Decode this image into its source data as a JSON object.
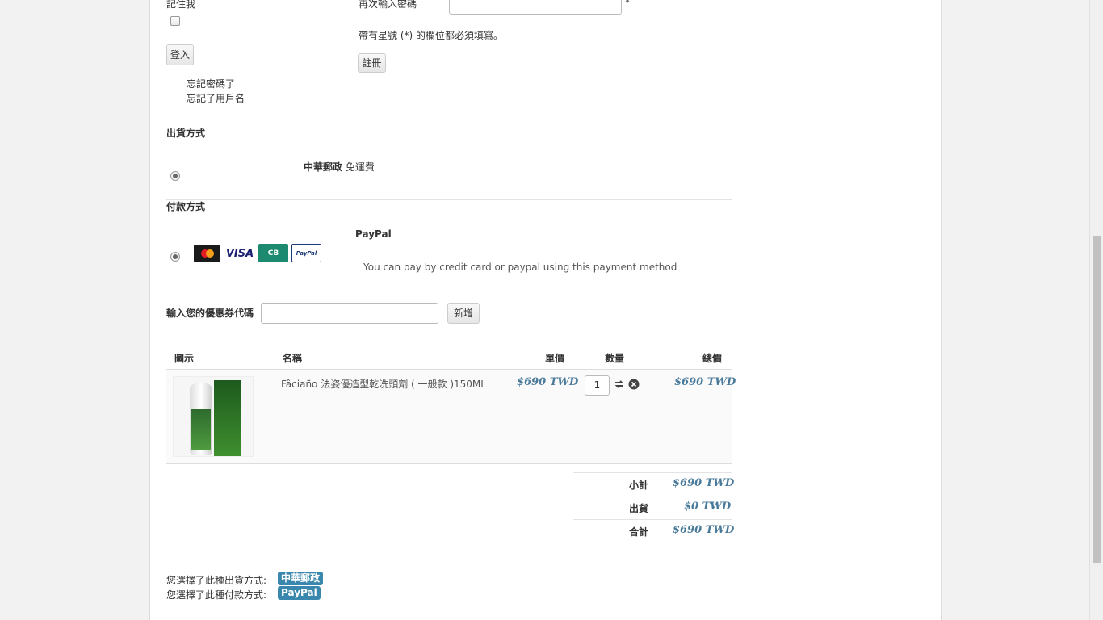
{
  "login": {
    "remember_label": "記住我",
    "login_button": "登入",
    "forgot_password": "忘記密碼了",
    "forgot_username": "忘記了用戶名"
  },
  "register": {
    "confirm_password_label": "再次輸入密碼",
    "required_marker": "*",
    "required_note": "帶有星號 (*) 的欄位都必須填寫。",
    "register_button": "註冊"
  },
  "shipping": {
    "heading": "出貨方式",
    "option_name": "中華郵政",
    "option_detail": "免運費"
  },
  "payment": {
    "heading": "付款方式",
    "option_name": "PayPal",
    "description": "You can pay by credit card or paypal using this payment method",
    "cards": [
      "MasterCard",
      "VISA",
      "CB",
      "PayPal"
    ]
  },
  "coupon": {
    "label": "輸入您的優惠券代碼",
    "input_value": "",
    "add_button": "新增"
  },
  "cart": {
    "headers": {
      "image": "圖示",
      "name": "名稱",
      "unit_price": "單價",
      "quantity": "數量",
      "total": "總價"
    },
    "items": [
      {
        "name": "Fâciaño 法姿優造型乾洗頭劑 ( 一般款 )150ML",
        "unit_price": "$690 TWD",
        "quantity": "1",
        "total": "$690 TWD"
      }
    ],
    "summary": [
      {
        "label": "小計",
        "value": "$690 TWD"
      },
      {
        "label": "出貨",
        "value": "$0 TWD"
      },
      {
        "label": "合計",
        "value": "$690 TWD"
      }
    ]
  },
  "selection": {
    "shipping_text": "您選擇了此種出貨方式:",
    "shipping_badge": "中華郵政",
    "payment_text": "您選擇了此種付款方式:",
    "payment_badge": "PayPal"
  },
  "colors": {
    "price": "#4a7a9a",
    "badge": "#3a87ad"
  }
}
